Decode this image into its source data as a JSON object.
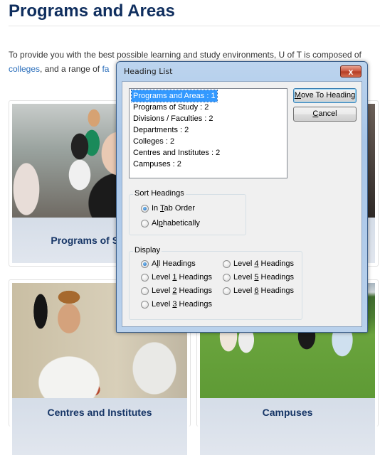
{
  "page": {
    "title": "Programs and Areas",
    "intro_line1": "To provide you with the best possible learning and study environments, U of T is composed of",
    "intro_link1": "colleges",
    "intro_mid": ", and a range of ",
    "intro_link2": "fa"
  },
  "cards": [
    {
      "label": "Programs of Study",
      "visible_label": "Programs of"
    },
    {
      "label": "Centres and Institutes"
    },
    {
      "label": "Campuses"
    }
  ],
  "dialog": {
    "title": "Heading List",
    "close_label": "x",
    "headings": [
      {
        "text": "Programs and Areas : 1",
        "selected": true
      },
      {
        "text": "Programs of Study : 2"
      },
      {
        "text": "Divisions / Faculties : 2"
      },
      {
        "text": "Departments : 2"
      },
      {
        "text": "Colleges : 2"
      },
      {
        "text": "Centres and Institutes : 2"
      },
      {
        "text": "Campuses : 2"
      }
    ],
    "buttons": {
      "move_pre": "",
      "move_key": "M",
      "move_post": "ove To Heading",
      "cancel_pre": "",
      "cancel_key": "C",
      "cancel_post": "ancel"
    },
    "sort": {
      "label": "Sort Headings",
      "options": [
        {
          "pre": "In ",
          "key": "T",
          "post": "ab Order",
          "checked": true
        },
        {
          "pre": "Al",
          "key": "p",
          "post": "habetically",
          "checked": false
        }
      ]
    },
    "display": {
      "label": "Display",
      "options": [
        {
          "pre": "A",
          "key": "l",
          "post": "l Headings",
          "checked": true
        },
        {
          "pre": "Level ",
          "key": "1",
          "post": " Headings",
          "checked": false
        },
        {
          "pre": "Level ",
          "key": "2",
          "post": " Headings",
          "checked": false
        },
        {
          "pre": "Level ",
          "key": "3",
          "post": " Headings",
          "checked": false
        },
        {
          "pre": "Level ",
          "key": "4",
          "post": " Headings",
          "checked": false
        },
        {
          "pre": "Level ",
          "key": "5",
          "post": " Headings",
          "checked": false
        },
        {
          "pre": "Level ",
          "key": "6",
          "post": " Headings",
          "checked": false
        }
      ]
    }
  }
}
